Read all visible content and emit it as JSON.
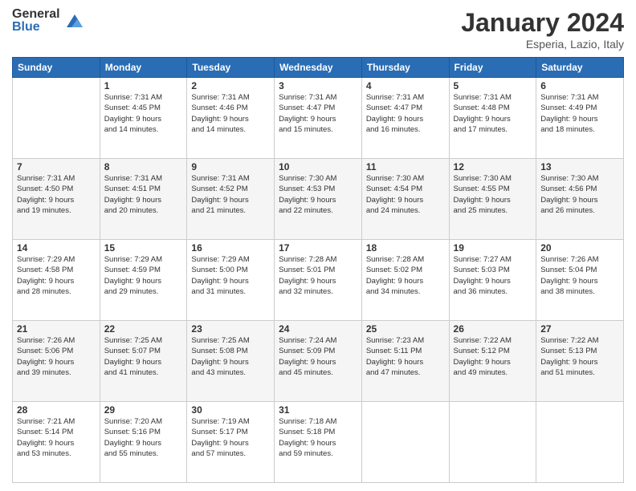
{
  "header": {
    "logo_general": "General",
    "logo_blue": "Blue",
    "month_year": "January 2024",
    "location": "Esperia, Lazio, Italy"
  },
  "weekdays": [
    "Sunday",
    "Monday",
    "Tuesday",
    "Wednesday",
    "Thursday",
    "Friday",
    "Saturday"
  ],
  "weeks": [
    [
      {
        "day": "",
        "info": ""
      },
      {
        "day": "1",
        "info": "Sunrise: 7:31 AM\nSunset: 4:45 PM\nDaylight: 9 hours\nand 14 minutes."
      },
      {
        "day": "2",
        "info": "Sunrise: 7:31 AM\nSunset: 4:46 PM\nDaylight: 9 hours\nand 14 minutes."
      },
      {
        "day": "3",
        "info": "Sunrise: 7:31 AM\nSunset: 4:47 PM\nDaylight: 9 hours\nand 15 minutes."
      },
      {
        "day": "4",
        "info": "Sunrise: 7:31 AM\nSunset: 4:47 PM\nDaylight: 9 hours\nand 16 minutes."
      },
      {
        "day": "5",
        "info": "Sunrise: 7:31 AM\nSunset: 4:48 PM\nDaylight: 9 hours\nand 17 minutes."
      },
      {
        "day": "6",
        "info": "Sunrise: 7:31 AM\nSunset: 4:49 PM\nDaylight: 9 hours\nand 18 minutes."
      }
    ],
    [
      {
        "day": "7",
        "info": "Sunrise: 7:31 AM\nSunset: 4:50 PM\nDaylight: 9 hours\nand 19 minutes."
      },
      {
        "day": "8",
        "info": "Sunrise: 7:31 AM\nSunset: 4:51 PM\nDaylight: 9 hours\nand 20 minutes."
      },
      {
        "day": "9",
        "info": "Sunrise: 7:31 AM\nSunset: 4:52 PM\nDaylight: 9 hours\nand 21 minutes."
      },
      {
        "day": "10",
        "info": "Sunrise: 7:30 AM\nSunset: 4:53 PM\nDaylight: 9 hours\nand 22 minutes."
      },
      {
        "day": "11",
        "info": "Sunrise: 7:30 AM\nSunset: 4:54 PM\nDaylight: 9 hours\nand 24 minutes."
      },
      {
        "day": "12",
        "info": "Sunrise: 7:30 AM\nSunset: 4:55 PM\nDaylight: 9 hours\nand 25 minutes."
      },
      {
        "day": "13",
        "info": "Sunrise: 7:30 AM\nSunset: 4:56 PM\nDaylight: 9 hours\nand 26 minutes."
      }
    ],
    [
      {
        "day": "14",
        "info": "Sunrise: 7:29 AM\nSunset: 4:58 PM\nDaylight: 9 hours\nand 28 minutes."
      },
      {
        "day": "15",
        "info": "Sunrise: 7:29 AM\nSunset: 4:59 PM\nDaylight: 9 hours\nand 29 minutes."
      },
      {
        "day": "16",
        "info": "Sunrise: 7:29 AM\nSunset: 5:00 PM\nDaylight: 9 hours\nand 31 minutes."
      },
      {
        "day": "17",
        "info": "Sunrise: 7:28 AM\nSunset: 5:01 PM\nDaylight: 9 hours\nand 32 minutes."
      },
      {
        "day": "18",
        "info": "Sunrise: 7:28 AM\nSunset: 5:02 PM\nDaylight: 9 hours\nand 34 minutes."
      },
      {
        "day": "19",
        "info": "Sunrise: 7:27 AM\nSunset: 5:03 PM\nDaylight: 9 hours\nand 36 minutes."
      },
      {
        "day": "20",
        "info": "Sunrise: 7:26 AM\nSunset: 5:04 PM\nDaylight: 9 hours\nand 38 minutes."
      }
    ],
    [
      {
        "day": "21",
        "info": "Sunrise: 7:26 AM\nSunset: 5:06 PM\nDaylight: 9 hours\nand 39 minutes."
      },
      {
        "day": "22",
        "info": "Sunrise: 7:25 AM\nSunset: 5:07 PM\nDaylight: 9 hours\nand 41 minutes."
      },
      {
        "day": "23",
        "info": "Sunrise: 7:25 AM\nSunset: 5:08 PM\nDaylight: 9 hours\nand 43 minutes."
      },
      {
        "day": "24",
        "info": "Sunrise: 7:24 AM\nSunset: 5:09 PM\nDaylight: 9 hours\nand 45 minutes."
      },
      {
        "day": "25",
        "info": "Sunrise: 7:23 AM\nSunset: 5:11 PM\nDaylight: 9 hours\nand 47 minutes."
      },
      {
        "day": "26",
        "info": "Sunrise: 7:22 AM\nSunset: 5:12 PM\nDaylight: 9 hours\nand 49 minutes."
      },
      {
        "day": "27",
        "info": "Sunrise: 7:22 AM\nSunset: 5:13 PM\nDaylight: 9 hours\nand 51 minutes."
      }
    ],
    [
      {
        "day": "28",
        "info": "Sunrise: 7:21 AM\nSunset: 5:14 PM\nDaylight: 9 hours\nand 53 minutes."
      },
      {
        "day": "29",
        "info": "Sunrise: 7:20 AM\nSunset: 5:16 PM\nDaylight: 9 hours\nand 55 minutes."
      },
      {
        "day": "30",
        "info": "Sunrise: 7:19 AM\nSunset: 5:17 PM\nDaylight: 9 hours\nand 57 minutes."
      },
      {
        "day": "31",
        "info": "Sunrise: 7:18 AM\nSunset: 5:18 PM\nDaylight: 9 hours\nand 59 minutes."
      },
      {
        "day": "",
        "info": ""
      },
      {
        "day": "",
        "info": ""
      },
      {
        "day": "",
        "info": ""
      }
    ]
  ]
}
